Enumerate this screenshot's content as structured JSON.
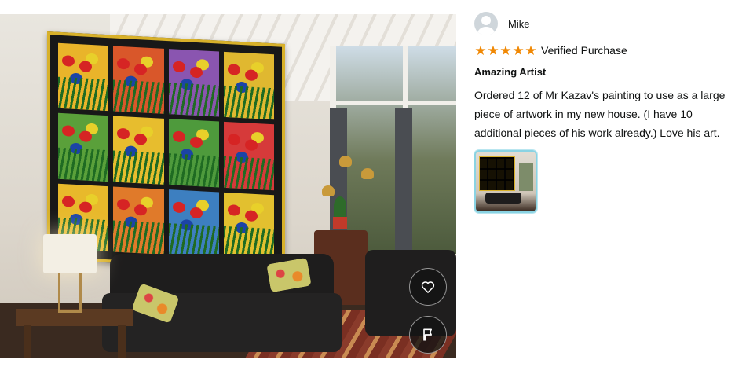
{
  "review": {
    "reviewer_name": "Mike",
    "rating": 5,
    "rating_max": 5,
    "stars": [
      "★",
      "★",
      "★",
      "★",
      "★"
    ],
    "verified_label": "Verified Purchase",
    "title": "Amazing Artist",
    "body": "Ordered 12 of Mr Kazav's painting to use as a large piece of artwork in my new house. (I have 10 additional pieces of his work already.) Love his art."
  },
  "photo_buttons": {
    "like_icon": "heart-icon",
    "report_icon": "flag-icon"
  },
  "colors": {
    "star": "#f08804",
    "thumb_border": "#8ad3e3",
    "button_bg": "#141414"
  }
}
